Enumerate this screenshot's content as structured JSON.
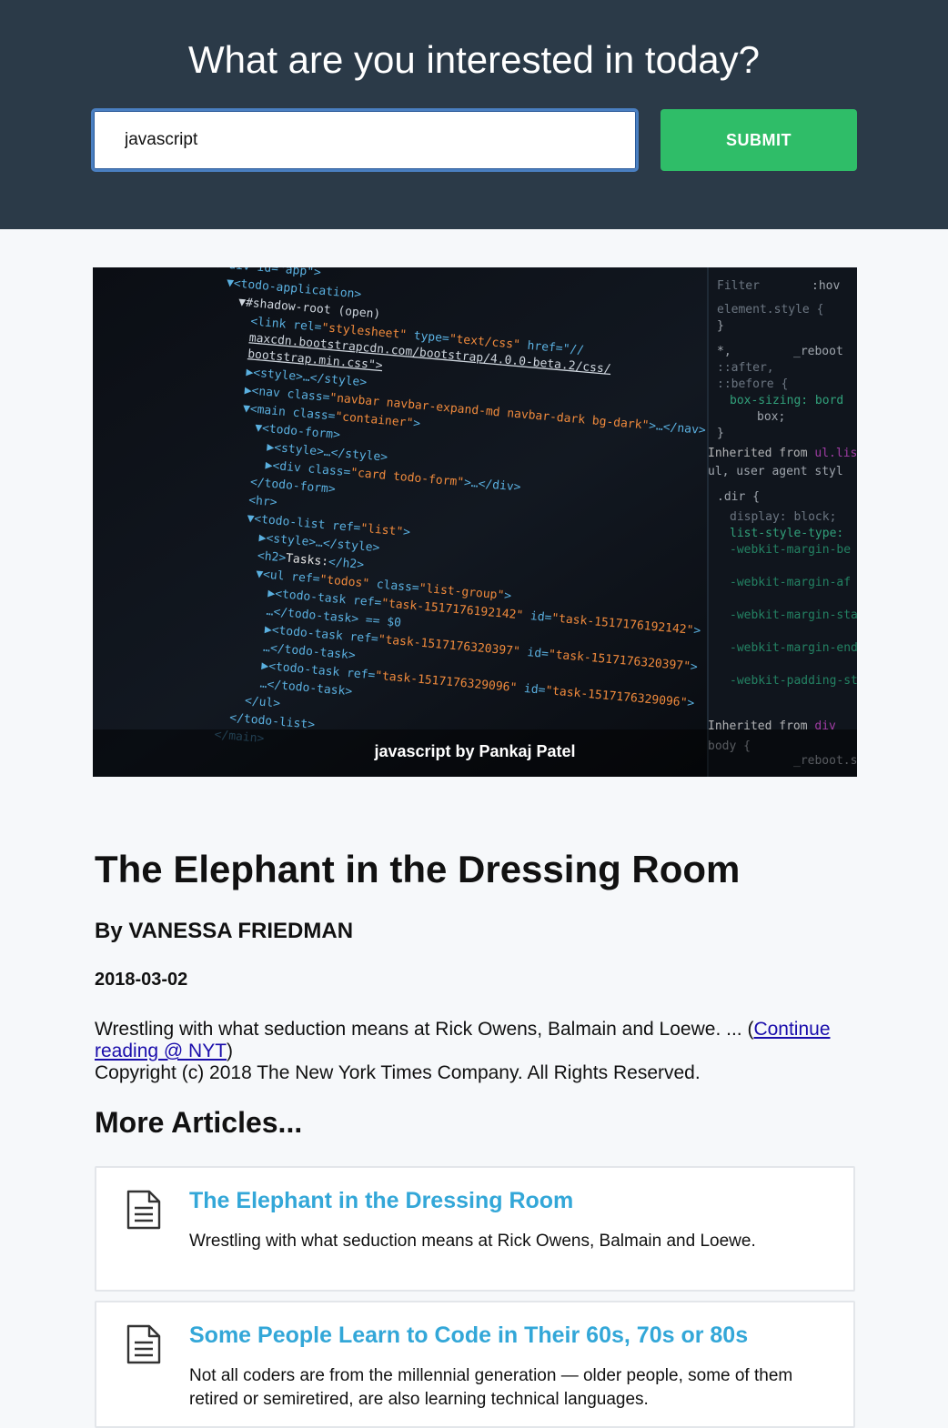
{
  "header": {
    "title": "What are you interested in today?",
    "search_value": "javascript",
    "submit_label": "SUBMIT",
    "accent": "#2fbd68",
    "background": "#2b3a48"
  },
  "hero_image": {
    "caption": "javascript by Pankaj Patel"
  },
  "article": {
    "title": "The Elephant in the Dressing Room",
    "byline": "By VANESSA FRIEDMAN",
    "date": "2018-03-02",
    "summary": "Wrestling with what seduction means at Rick Owens, Balmain and Loewe. ... (",
    "link_text": "Continue reading @ NYT",
    "summary_end": ")",
    "copyright": "Copyright (c) 2018 The New York Times Company. All Rights Reserved."
  },
  "more": {
    "heading": "More Articles...",
    "items": [
      {
        "title": "The Elephant in the Dressing Room",
        "description": "Wrestling with what seduction means at Rick Owens, Balmain and Loewe.",
        "icon": "document-icon"
      },
      {
        "title": "Some People Learn to Code in Their 60s, 70s or 80s",
        "description": "Not all coders are from the millennial generation — older people, some of them retired or semiretired, are also learning technical languages.",
        "icon": "document-icon"
      }
    ]
  }
}
